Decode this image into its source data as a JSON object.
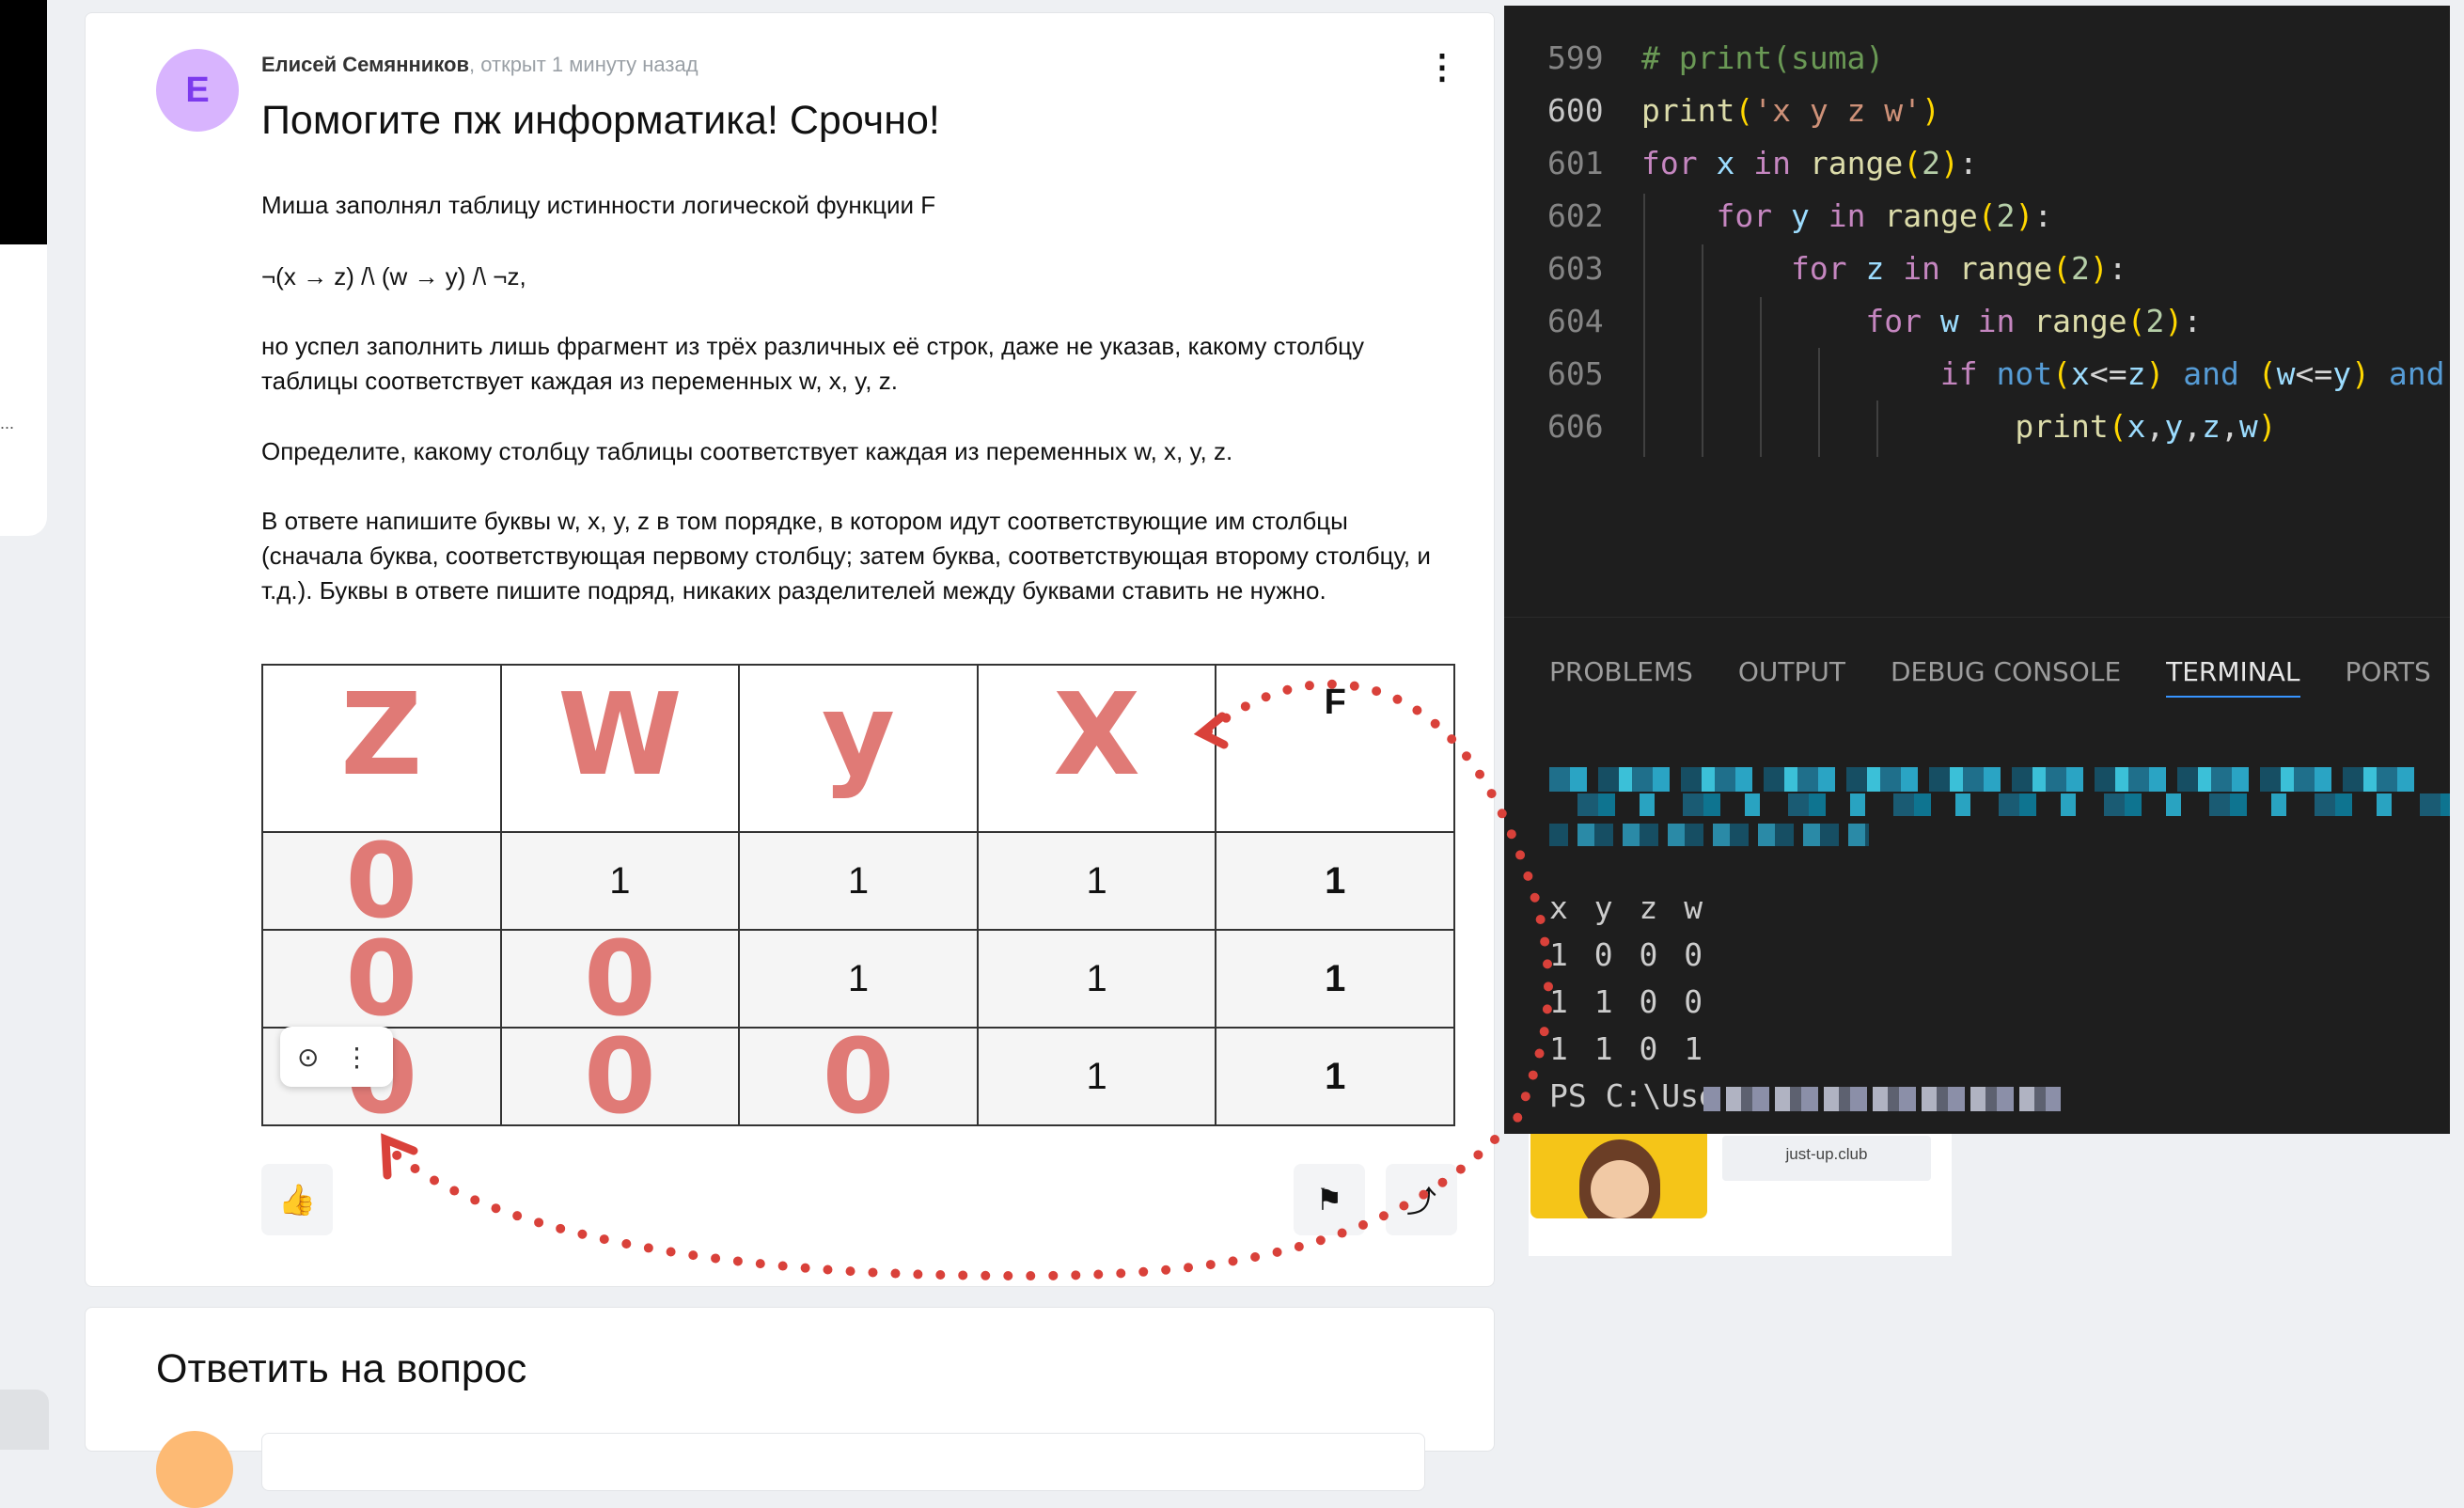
{
  "question": {
    "avatar_letter": "Е",
    "author": "Елисей Семянников",
    "meta_suffix": ", открыт 1 минуту назад",
    "title": "Помогите пж информатика! Срочно!",
    "paragraphs": [
      "Миша заполнял таблицу истинности логической функции F",
      "¬(x → z) /\\ (w → y) /\\ ¬z,",
      "но успел заполнить лишь фрагмент из трёх различных её строк, даже не указав, какому столбцу таблицы соответствует каждая из переменных w, x, y, z.",
      "Определите, какому столбцу таблицы соответствует каждая из переменных w, x, y, z.",
      "В ответе напишите буквы w, x, y, z в том порядке, в котором идут соответствующие им столбцы (сначала буква, соответствующая первому столбцу; затем буква, соответствующая второму столбцу, и т.д.). Буквы в ответе пишите подряд, никаких разделителей между буквами ставить не нужно."
    ],
    "table": {
      "header": [
        "",
        "",
        "",
        "",
        "F"
      ],
      "rows": [
        [
          "",
          "1",
          "1",
          "1",
          "1"
        ],
        [
          "",
          "",
          "1",
          "1",
          "1"
        ],
        [
          "",
          "",
          "",
          "1",
          "1"
        ]
      ]
    },
    "handwriting": {
      "headers": [
        "Z",
        "W",
        "y",
        "X"
      ],
      "zeros": "0"
    },
    "kebab": "⋮",
    "image_tools": {
      "camera": "⊙",
      "more": "⋮"
    },
    "actions": {
      "like": "👍",
      "bookmark": "⚑",
      "share": "⤴"
    }
  },
  "answer": {
    "title": "Ответить на вопрос"
  },
  "ad": {
    "button": "just-up.club"
  },
  "left": {
    "dots": "..."
  },
  "editor": {
    "lines": [
      {
        "num": "599"
      },
      {
        "num": "600"
      },
      {
        "num": "601"
      },
      {
        "num": "602"
      },
      {
        "num": "603"
      },
      {
        "num": "604"
      },
      {
        "num": "605"
      },
      {
        "num": "606"
      }
    ],
    "tabs": [
      "PROBLEMS",
      "OUTPUT",
      "DEBUG CONSOLE",
      "TERMINAL",
      "PORTS"
    ],
    "terminal": [
      "x y z w",
      "1 0 0 0",
      "1 1 0 0",
      "1 1 0 1",
      "PS C:\\Users"
    ]
  }
}
